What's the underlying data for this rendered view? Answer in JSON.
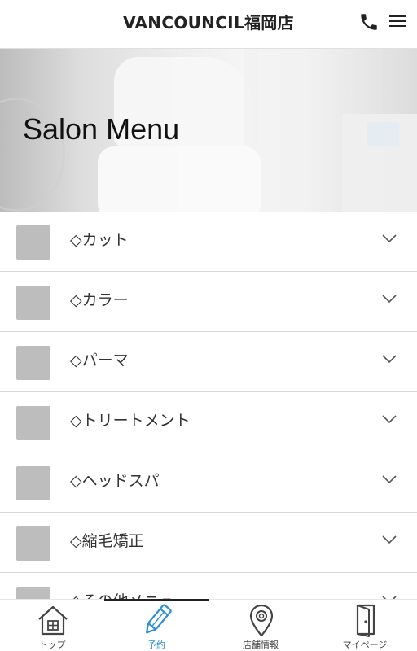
{
  "header": {
    "title": "VANCOUNCIL福岡店",
    "phone_icon": "phone-icon",
    "menu_icon": "hamburger-menu-icon"
  },
  "hero": {
    "title": "Salon Menu"
  },
  "menu": {
    "items": [
      {
        "label": "◇カット"
      },
      {
        "label": "◇カラー"
      },
      {
        "label": "◇パーマ"
      },
      {
        "label": "◇トリートメント"
      },
      {
        "label": "◇ヘッドスパ"
      },
      {
        "label": "◇縮毛矯正"
      },
      {
        "label": "◇その他メニュー"
      }
    ]
  },
  "bottom_nav": {
    "items": [
      {
        "label": "トップ",
        "icon": "home-icon",
        "active": false
      },
      {
        "label": "予約",
        "icon": "pencil-icon",
        "active": true
      },
      {
        "label": "店舗情報",
        "icon": "map-pin-icon",
        "active": false
      },
      {
        "label": "マイページ",
        "icon": "door-icon",
        "active": false
      }
    ]
  },
  "colors": {
    "accent": "#2a8fd6",
    "thumbnail": "#bdbdbd",
    "divider": "#d8d8d8"
  }
}
